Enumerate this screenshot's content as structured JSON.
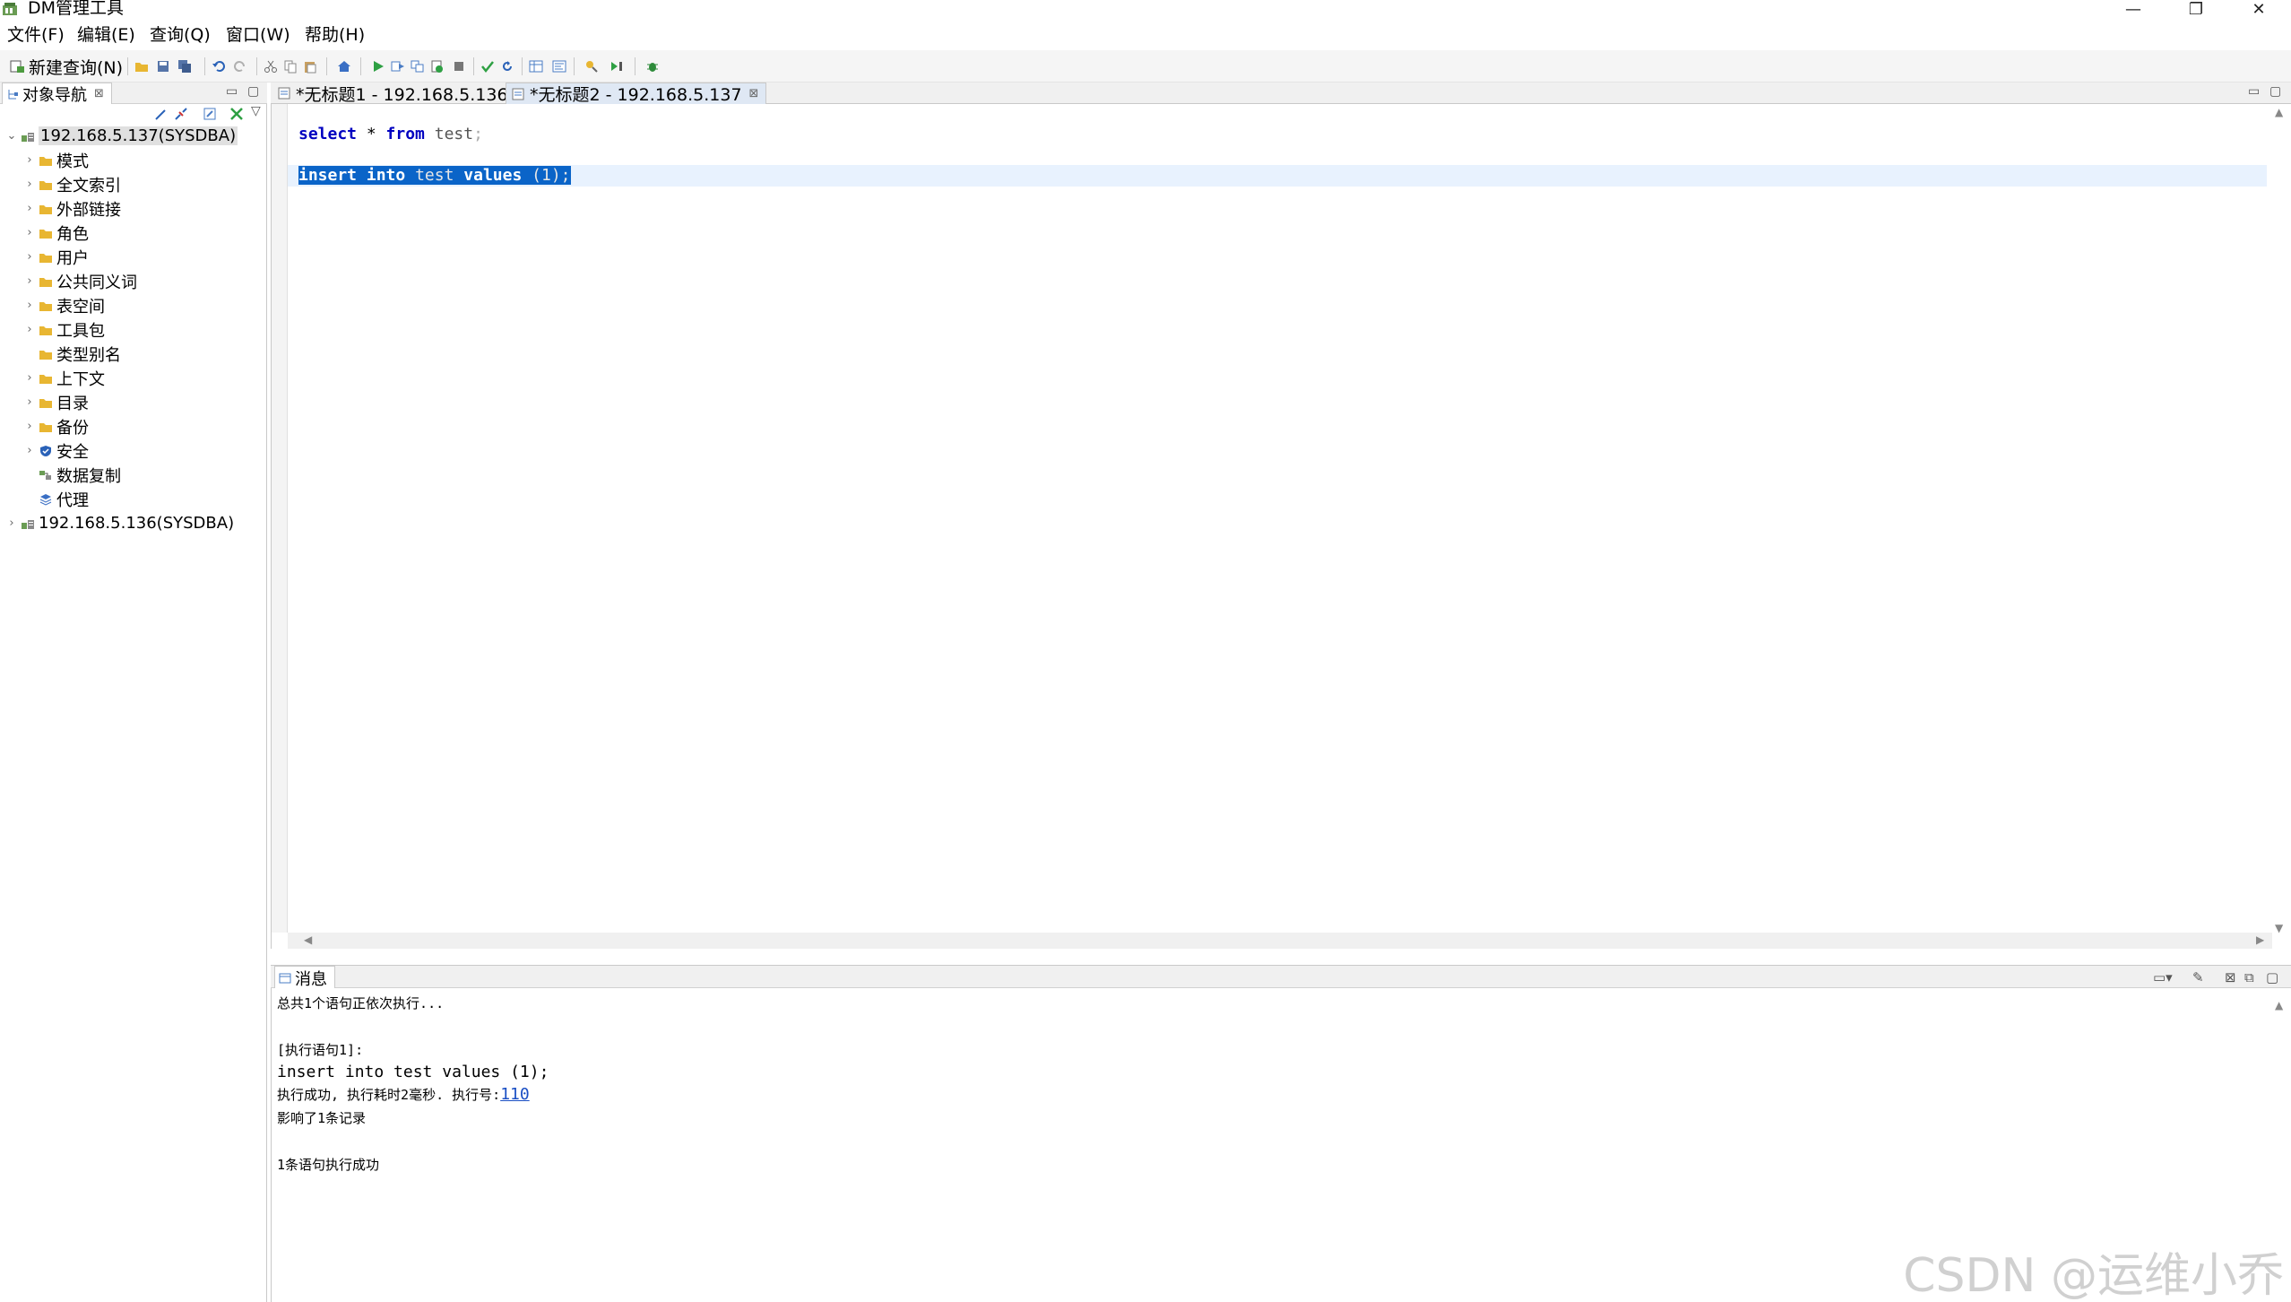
{
  "window": {
    "title": "DM管理工具",
    "minimize": "—",
    "maximize": "❐",
    "close": "✕"
  },
  "menu": {
    "file": "文件(F)",
    "edit": "编辑(E)",
    "query": "查询(Q)",
    "window": "窗口(W)",
    "help": "帮助(H)"
  },
  "toolbar": {
    "new_query": "新建查询(N)"
  },
  "navigator": {
    "tab_label": "对象导航",
    "tree": [
      {
        "label": "192.168.5.137(SYSDBA)",
        "level": 0,
        "expanded": true,
        "icon": "server-icon",
        "selected": true
      },
      {
        "label": "模式",
        "level": 1,
        "icon": "folder-icon"
      },
      {
        "label": "全文索引",
        "level": 1,
        "icon": "folder-icon"
      },
      {
        "label": "外部链接",
        "level": 1,
        "icon": "folder-icon"
      },
      {
        "label": "角色",
        "level": 1,
        "icon": "folder-icon"
      },
      {
        "label": "用户",
        "level": 1,
        "icon": "folder-icon"
      },
      {
        "label": "公共同义词",
        "level": 1,
        "icon": "folder-icon"
      },
      {
        "label": "表空间",
        "level": 1,
        "icon": "folder-icon"
      },
      {
        "label": "工具包",
        "level": 1,
        "icon": "folder-icon"
      },
      {
        "label": "类型别名",
        "level": 1,
        "icon": "folder-icon",
        "leaf": true
      },
      {
        "label": "上下文",
        "level": 1,
        "icon": "folder-icon"
      },
      {
        "label": "目录",
        "level": 1,
        "icon": "folder-icon"
      },
      {
        "label": "备份",
        "level": 1,
        "icon": "folder-icon"
      },
      {
        "label": "安全",
        "level": 1,
        "icon": "shield-icon"
      },
      {
        "label": "数据复制",
        "level": 1,
        "icon": "replication-icon",
        "leaf": true
      },
      {
        "label": "代理",
        "level": 1,
        "icon": "agent-icon",
        "leaf": true
      },
      {
        "label": "192.168.5.136(SYSDBA)",
        "level": 0,
        "expanded": false,
        "icon": "server-icon"
      }
    ]
  },
  "editor": {
    "tabs": [
      {
        "label": "*无标题1 - 192.168.5.136",
        "active": false
      },
      {
        "label": "*无标题2 - 192.168.5.137",
        "active": true
      }
    ],
    "line1": {
      "kw1": "select",
      "t1": " * ",
      "kw2": "from",
      "t2": " ",
      "id1": "test",
      "t3": ";"
    },
    "line2": {
      "kw1": "insert",
      "t1": " ",
      "kw2": "into",
      "t2": " ",
      "id1": "test",
      "t3": " ",
      "kw3": "values",
      "t4": " (1);"
    }
  },
  "messages": {
    "tab_label": "消息",
    "lines": {
      "l1": "总共1个语句正依次执行...",
      "l2": "[执行语句1]:",
      "l3": "insert into test values (1);",
      "l4_prefix": "执行成功, 执行耗时2毫秒. 执行号:",
      "l4_link": "110",
      "l5": "影响了1条记录",
      "l6": "1条语句执行成功"
    }
  },
  "watermark": "CSDN @运维小乔",
  "colors": {
    "keyword": "#0000c0",
    "selection": "#0a64c8",
    "current_line": "#e8f2fe",
    "folder": "#e8b632",
    "link": "#1a4fc4"
  }
}
